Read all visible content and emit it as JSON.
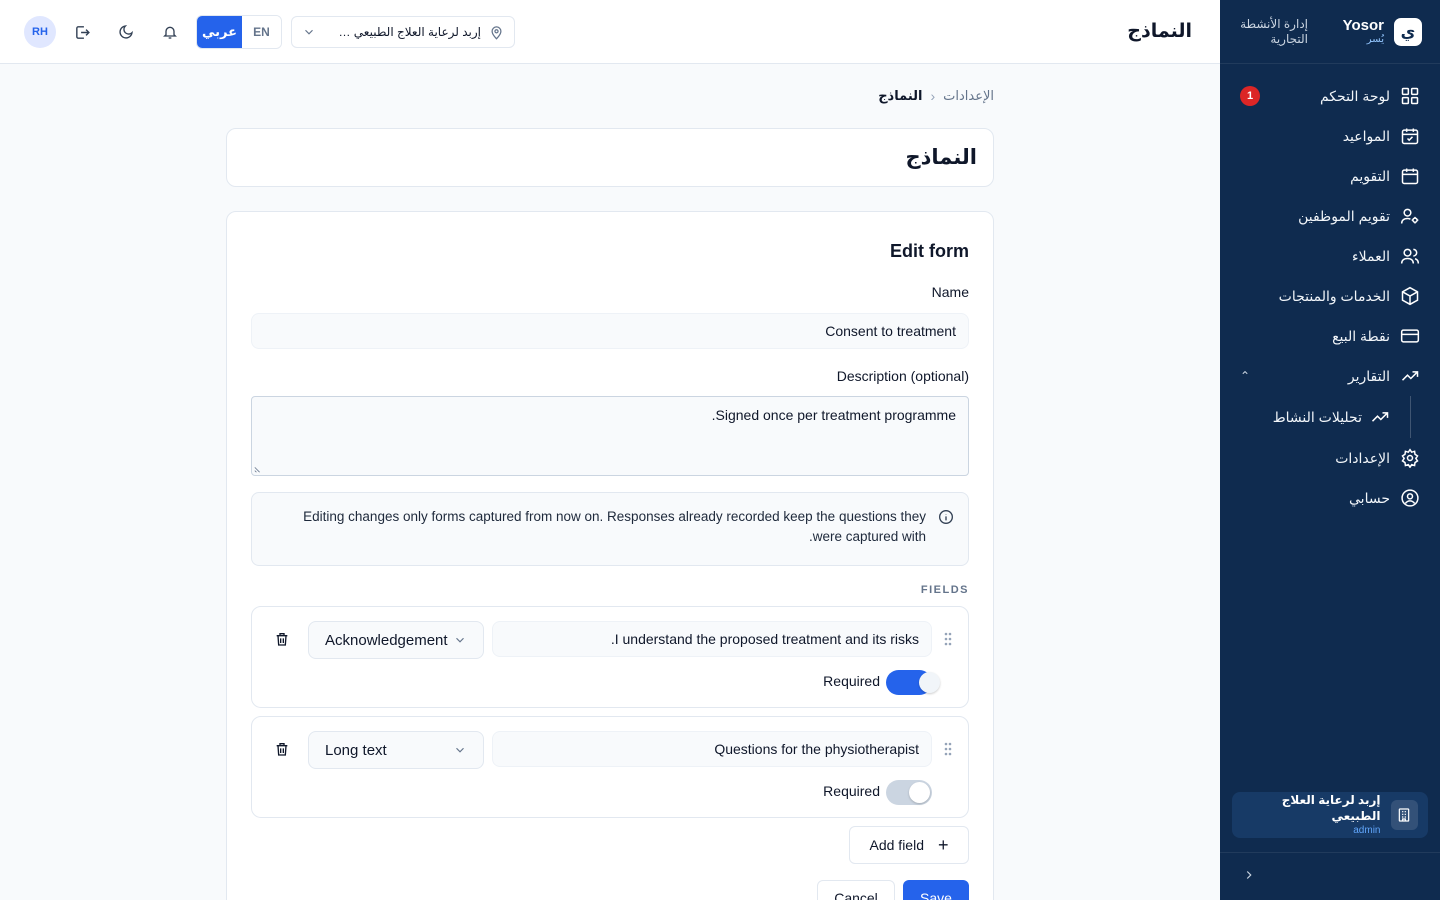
{
  "brand": {
    "logo_glyph": "ي",
    "name": "Yosor",
    "name_ar": "يُسر",
    "tagline": "إدارة الأنشطة التجارية"
  },
  "sidebar": {
    "items": [
      {
        "label": "لوحة التحكم",
        "icon": "dashboard-icon",
        "badge": "1"
      },
      {
        "label": "المواعيد",
        "icon": "calendar-check-icon"
      },
      {
        "label": "التقويم",
        "icon": "calendar-icon"
      },
      {
        "label": "تقويم الموظفين",
        "icon": "user-cog-icon"
      },
      {
        "label": "العملاء",
        "icon": "users-icon"
      },
      {
        "label": "الخدمات والمنتجات",
        "icon": "box-icon"
      },
      {
        "label": "نقطة البيع",
        "icon": "credit-card-icon"
      },
      {
        "label": "التقارير",
        "icon": "trending-up-icon",
        "expanded": true
      },
      {
        "label": "الإعدادات",
        "icon": "gear-icon"
      },
      {
        "label": "حسابي",
        "icon": "user-circle-icon"
      }
    ],
    "sub_items": [
      {
        "label": "تحليلات النشاط",
        "icon": "trending-up-icon"
      }
    ],
    "org": {
      "name": "إربد لرعاية العلاج الطبيعي",
      "role": "admin"
    }
  },
  "topbar": {
    "page_title": "النماذج",
    "location": "إربد لرعاية العلاج الطبيعي — ...",
    "lang_en": "EN",
    "lang_ar": "عربي",
    "avatar_initials": "RH"
  },
  "breadcrumb": {
    "parent": "الإعدادات",
    "current": "النماذج"
  },
  "page": {
    "title": "النماذج"
  },
  "form": {
    "title": "Edit form",
    "name_label": "Name",
    "name_value": "Consent to treatment",
    "description_label": "Description (optional)",
    "description_value": ".Signed once per treatment programme",
    "notice": "Editing changes only forms captured from now on. Responses already recorded keep the questions they .were captured with",
    "fields_heading": "FIELDS",
    "fields": [
      {
        "question": ".I understand the proposed treatment and its risks",
        "type": "Acknowledgement",
        "required_label": "Required",
        "required": true
      },
      {
        "question": "Questions for the physiotherapist",
        "type": "Long text",
        "required_label": "Required",
        "required": false
      }
    ],
    "add_field_label": "Add field",
    "cancel_label": "Cancel",
    "save_label": "Save"
  },
  "colors": {
    "sidebar_bg": "#0f2b4f",
    "accent": "#2563eb",
    "badge": "#dc2626"
  }
}
